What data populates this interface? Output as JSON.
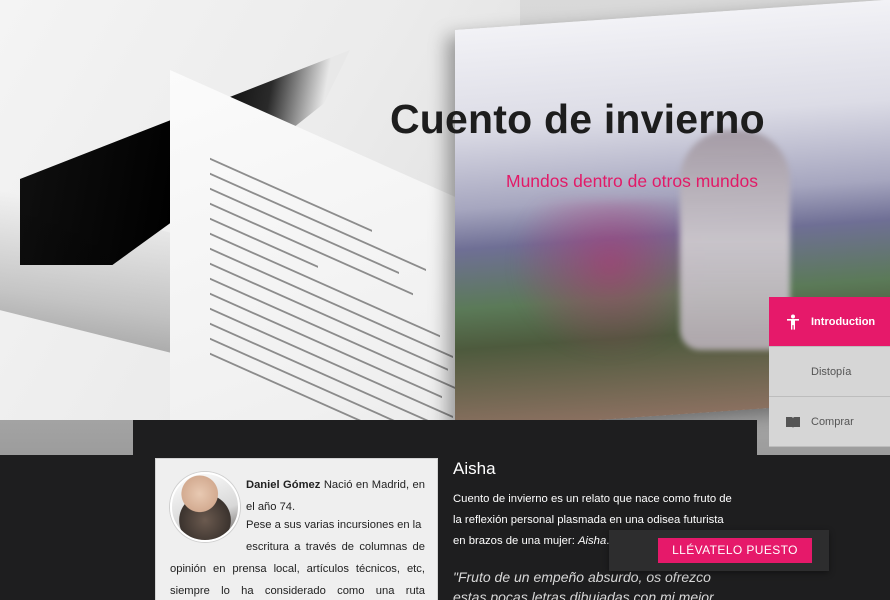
{
  "hero": {
    "title": "Cuento de invierno",
    "subtitle": "Mundos dentro de otros mundos",
    "accent_color": "#e6196a"
  },
  "sidenav": {
    "items": [
      {
        "label": "Introduction",
        "icon": "person-icon",
        "active": true
      },
      {
        "label": "Distopía",
        "icon": "moon-icon",
        "active": false
      },
      {
        "label": "Comprar",
        "icon": "book-icon",
        "active": false
      }
    ]
  },
  "author": {
    "name": "Daniel Gómez",
    "intro": "Nació en Madrid, en el año 74.",
    "para_start": "Pese a sus varias incursiones en la",
    "para_rest": "escritura a través de columnas de opinión en prensa local, artículos técnicos, etc, siempre lo ha considerado como una ruta orientada a"
  },
  "section": {
    "title": "Aisha",
    "body": "Cuento de invierno es un relato que nace como fruto de la reflexión personal plasmada en una odisea futurista en brazos de una mujer:",
    "body_emph": "Aisha",
    "body_end": ".",
    "quote_line1": "\"Fruto de un empeño absurdo, os ofrezco",
    "quote_line2": "estas pocas letras dibujadas con mi mejor"
  },
  "cta": {
    "label": "LLÉVATELO PUESTO"
  }
}
